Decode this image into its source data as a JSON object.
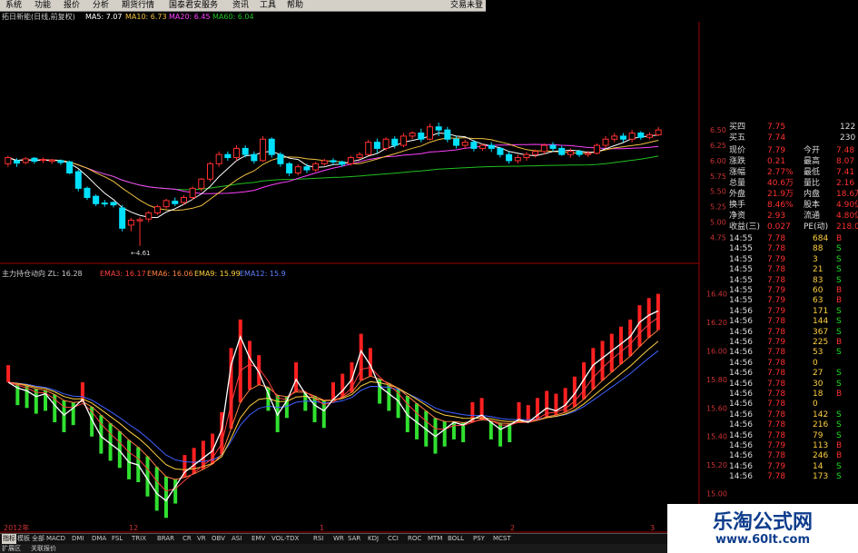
{
  "menu": {
    "items": [
      "系统",
      "功能",
      "报价",
      "分析",
      "期货行情",
      "国泰君安服务",
      "资讯",
      "工具",
      "帮助"
    ],
    "right": "交易未登"
  },
  "topstrip": {
    "stock": "拓日新能(日线,前复权)",
    "ma5": "MA5: 7.07",
    "ma10": "MA10: 6.73",
    "ma20": "MA20: 6.45",
    "ma60": "MA60: 6.04"
  },
  "indicator_legend": {
    "name": "主力持仓动向 ZL: 16.28",
    "ema3": "EMA3: 16.17",
    "ema6": "EMA6: 16.06",
    "ema9": "EMA9: 15.99",
    "ema12": "EMA12: 15.9"
  },
  "colors": {
    "up": "#ff3030",
    "down": "#00e0ff",
    "bar_up": "#ff2020",
    "bar_down": "#30e030",
    "ma5": "#ffffff",
    "ma10": "#f0c040",
    "ma20": "#ff40ff",
    "ma60": "#20c020"
  },
  "chart_data": [
    {
      "type": "candlestick",
      "title": "拓日新能(日线,前复权)",
      "y_ticks": [
        "6.50",
        "6.25",
        "6.00",
        "5.75",
        "5.50",
        "5.25",
        "5.00",
        "4.75"
      ],
      "ylim": [
        4.55,
        6.62
      ],
      "low_marker": "4.61",
      "candles": [
        [
          5.95,
          6.05,
          5.9,
          6.08
        ],
        [
          6.0,
          5.96,
          5.9,
          6.04
        ],
        [
          5.97,
          6.03,
          5.94,
          6.06
        ],
        [
          6.04,
          5.99,
          5.95,
          6.06
        ],
        [
          6.01,
          6.02,
          5.96,
          6.05
        ],
        [
          5.99,
          6.01,
          5.95,
          6.03
        ],
        [
          6.0,
          5.97,
          5.93,
          6.02
        ],
        [
          5.98,
          5.8,
          5.78,
          6.0
        ],
        [
          5.82,
          5.55,
          5.5,
          5.85
        ],
        [
          5.55,
          5.4,
          5.36,
          5.58
        ],
        [
          5.42,
          5.3,
          5.26,
          5.45
        ],
        [
          5.31,
          5.3,
          5.25,
          5.36
        ],
        [
          5.32,
          5.28,
          5.24,
          5.34
        ],
        [
          5.23,
          4.9,
          4.85,
          5.28
        ],
        [
          4.95,
          5.03,
          4.85,
          5.07
        ],
        [
          5.02,
          5.04,
          4.61,
          5.08
        ],
        [
          5.05,
          5.15,
          5.0,
          5.18
        ],
        [
          5.15,
          5.25,
          5.12,
          5.28
        ],
        [
          5.25,
          5.35,
          5.22,
          5.38
        ],
        [
          5.34,
          5.3,
          5.26,
          5.4
        ],
        [
          5.32,
          5.4,
          5.28,
          5.44
        ],
        [
          5.4,
          5.55,
          5.36,
          5.58
        ],
        [
          5.55,
          5.7,
          5.5,
          5.72
        ],
        [
          5.7,
          5.95,
          5.66,
          5.98
        ],
        [
          5.95,
          6.1,
          5.9,
          6.15
        ],
        [
          6.1,
          6.05,
          6.0,
          6.15
        ],
        [
          6.05,
          6.2,
          6.0,
          6.25
        ],
        [
          6.2,
          6.1,
          6.05,
          6.25
        ],
        [
          6.1,
          6.0,
          5.95,
          6.15
        ],
        [
          6.0,
          6.35,
          5.98,
          6.4
        ],
        [
          6.35,
          6.1,
          6.05,
          6.38
        ],
        [
          6.1,
          5.95,
          5.9,
          6.14
        ],
        [
          5.95,
          5.8,
          5.75,
          5.98
        ],
        [
          5.8,
          5.9,
          5.76,
          5.94
        ],
        [
          5.9,
          5.85,
          5.8,
          5.95
        ],
        [
          5.85,
          5.95,
          5.82,
          5.98
        ],
        [
          5.95,
          6.0,
          5.92,
          6.03
        ],
        [
          6.0,
          5.98,
          5.93,
          6.04
        ],
        [
          5.98,
          5.94,
          5.9,
          6.0
        ],
        [
          5.95,
          6.05,
          5.92,
          6.08
        ],
        [
          6.05,
          6.1,
          6.02,
          6.14
        ],
        [
          6.1,
          6.3,
          6.08,
          6.34
        ],
        [
          6.3,
          6.2,
          6.12,
          6.36
        ],
        [
          6.2,
          6.35,
          6.16,
          6.38
        ],
        [
          6.35,
          6.25,
          6.2,
          6.4
        ],
        [
          6.25,
          6.4,
          6.22,
          6.45
        ],
        [
          6.4,
          6.45,
          6.35,
          6.48
        ],
        [
          6.45,
          6.35,
          6.3,
          6.52
        ],
        [
          6.35,
          6.55,
          6.33,
          6.6
        ],
        [
          6.55,
          6.5,
          6.4,
          6.62
        ],
        [
          6.5,
          6.35,
          6.3,
          6.55
        ],
        [
          6.35,
          6.25,
          6.2,
          6.4
        ],
        [
          6.25,
          6.3,
          6.2,
          6.34
        ],
        [
          6.3,
          6.2,
          6.15,
          6.34
        ],
        [
          6.2,
          6.25,
          6.16,
          6.28
        ],
        [
          6.25,
          6.2,
          6.14,
          6.3
        ],
        [
          6.2,
          6.1,
          6.05,
          6.22
        ],
        [
          6.1,
          6.0,
          5.95,
          6.15
        ],
        [
          6.0,
          6.05,
          5.95,
          6.1
        ],
        [
          6.05,
          6.1,
          6.0,
          6.14
        ],
        [
          6.1,
          6.15,
          6.05,
          6.18
        ],
        [
          6.15,
          6.25,
          6.1,
          6.28
        ],
        [
          6.25,
          6.2,
          6.15,
          6.3
        ],
        [
          6.2,
          6.1,
          6.08,
          6.24
        ],
        [
          6.1,
          6.15,
          6.05,
          6.2
        ],
        [
          6.15,
          6.1,
          6.06,
          6.18
        ],
        [
          6.1,
          6.12,
          6.06,
          6.16
        ],
        [
          6.12,
          6.25,
          6.1,
          6.28
        ],
        [
          6.25,
          6.35,
          6.2,
          6.4
        ],
        [
          6.35,
          6.4,
          6.3,
          6.45
        ],
        [
          6.4,
          6.35,
          6.3,
          6.45
        ],
        [
          6.35,
          6.45,
          6.3,
          6.5
        ],
        [
          6.45,
          6.38,
          6.34,
          6.48
        ],
        [
          6.38,
          6.42,
          6.35,
          6.46
        ],
        [
          6.42,
          6.5,
          6.4,
          6.55
        ]
      ]
    },
    {
      "type": "bar",
      "title": "主力持仓动向 ZL: 16.28",
      "y_ticks": [
        "16.40",
        "16.20",
        "16.00",
        "15.80",
        "15.60",
        "15.40",
        "15.20",
        "15.00"
      ],
      "ylim": [
        14.8,
        16.55
      ],
      "values": [
        15.78,
        15.74,
        15.72,
        15.68,
        15.7,
        15.62,
        15.55,
        15.6,
        15.66,
        15.52,
        15.4,
        15.35,
        15.3,
        15.22,
        15.2,
        15.1,
        15.0,
        14.95,
        15.05,
        15.15,
        15.2,
        15.25,
        15.3,
        15.45,
        15.9,
        16.1,
        15.95,
        15.85,
        15.7,
        15.55,
        15.65,
        15.8,
        15.7,
        15.62,
        15.58,
        15.66,
        15.72,
        15.8,
        16.0,
        15.9,
        15.75,
        15.7,
        15.65,
        15.55,
        15.5,
        15.45,
        15.4,
        15.45,
        15.5,
        15.48,
        15.52,
        15.55,
        15.5,
        15.45,
        15.48,
        15.52,
        15.5,
        15.55,
        15.6,
        15.58,
        15.62,
        15.7,
        15.8,
        15.9,
        15.95,
        16.0,
        16.05,
        16.1,
        16.2,
        16.25,
        16.28
      ],
      "ema_series": [
        {
          "name": "EMA3",
          "color": "#ff4040"
        },
        {
          "name": "EMA6",
          "color": "#ff8040"
        },
        {
          "name": "EMA9",
          "color": "#ffd040"
        },
        {
          "name": "EMA12",
          "color": "#4060ff"
        }
      ]
    }
  ],
  "quote_panel": {
    "rows": [
      {
        "label": "买四",
        "value": "7.75",
        "extra": "122"
      },
      {
        "label": "买五",
        "value": "7.74",
        "extra": "230"
      },
      {
        "label": "现价",
        "value": "7.79",
        "label2": "今开",
        "value2": "7.48"
      },
      {
        "label": "涨跌",
        "value": "0.21",
        "label2": "最高",
        "value2": "8.07"
      },
      {
        "label": "涨幅",
        "value": "2.77%",
        "label2": "最低",
        "value2": "7.41"
      },
      {
        "label": "总量",
        "value": "40.6万",
        "label2": "量比",
        "value2": "2.16"
      },
      {
        "label": "外盘",
        "value": "21.9万",
        "label2": "内盘",
        "value2": "18.6万"
      },
      {
        "label": "换手",
        "value": "8.46%",
        "label2": "股本",
        "value2": "4.90亿"
      },
      {
        "label": "净资",
        "value": "2.93",
        "label2": "流通",
        "value2": "4.80亿"
      },
      {
        "label": "收益(三)",
        "value": "0.027",
        "label2": "PE(动)",
        "value2": "218.0"
      }
    ]
  },
  "ticks": [
    {
      "time": "14:55",
      "price": "7.78",
      "vol": "684",
      "bs": "B"
    },
    {
      "time": "14:55",
      "price": "7.78",
      "vol": "88",
      "bs": "S"
    },
    {
      "time": "14:55",
      "price": "7.79",
      "vol": "3",
      "bs": "S"
    },
    {
      "time": "14:55",
      "price": "7.78",
      "vol": "21",
      "bs": "S"
    },
    {
      "time": "14:55",
      "price": "7.78",
      "vol": "83",
      "bs": "S"
    },
    {
      "time": "14:55",
      "price": "7.79",
      "vol": "60",
      "bs": "B"
    },
    {
      "time": "14:55",
      "price": "7.79",
      "vol": "63",
      "bs": "B"
    },
    {
      "time": "14:56",
      "price": "7.79",
      "vol": "171",
      "bs": "S"
    },
    {
      "time": "14:56",
      "price": "7.78",
      "vol": "144",
      "bs": "S"
    },
    {
      "time": "14:56",
      "price": "7.78",
      "vol": "367",
      "bs": "S"
    },
    {
      "time": "14:56",
      "price": "7.79",
      "vol": "225",
      "bs": "B"
    },
    {
      "time": "14:56",
      "price": "7.78",
      "vol": "53",
      "bs": "S"
    },
    {
      "time": "14:56",
      "price": "7.78",
      "vol": "0",
      "bs": ""
    },
    {
      "time": "14:56",
      "price": "7.78",
      "vol": "27",
      "bs": "S"
    },
    {
      "time": "14:56",
      "price": "7.78",
      "vol": "30",
      "bs": "S"
    },
    {
      "time": "14:56",
      "price": "7.78",
      "vol": "18",
      "bs": "B"
    },
    {
      "time": "14:56",
      "price": "7.78",
      "vol": "0",
      "bs": ""
    },
    {
      "time": "14:56",
      "price": "7.78",
      "vol": "142",
      "bs": "S"
    },
    {
      "time": "14:56",
      "price": "7.78",
      "vol": "216",
      "bs": "S"
    },
    {
      "time": "14:56",
      "price": "7.78",
      "vol": "79",
      "bs": "S"
    },
    {
      "time": "14:56",
      "price": "7.79",
      "vol": "113",
      "bs": "B"
    },
    {
      "time": "14:56",
      "price": "7.78",
      "vol": "246",
      "bs": "B"
    },
    {
      "time": "14:56",
      "price": "7.79",
      "vol": "14",
      "bs": "S"
    },
    {
      "time": "14:56",
      "price": "7.78",
      "vol": "173",
      "bs": "S"
    }
  ],
  "time_axis": [
    "2012年",
    "12",
    "1",
    "2",
    "3"
  ],
  "bottom_tabs": [
    "指标",
    "模板",
    "全部",
    "MACD",
    "DMI",
    "DMA",
    "FSL",
    "TRIX",
    "BRAR",
    "CR",
    "VR",
    "OBV",
    "ASI",
    "EMV",
    "VOL-TDX",
    "RSI",
    "WR",
    "SAR",
    "KDJ",
    "CCI",
    "ROC",
    "MTM",
    "BOLL",
    "PSY",
    "MCST"
  ],
  "bottom2": [
    "扩展区",
    "关联报价"
  ],
  "watermark": {
    "title": "乐淘公式网",
    "url": "www.60lt.com"
  }
}
